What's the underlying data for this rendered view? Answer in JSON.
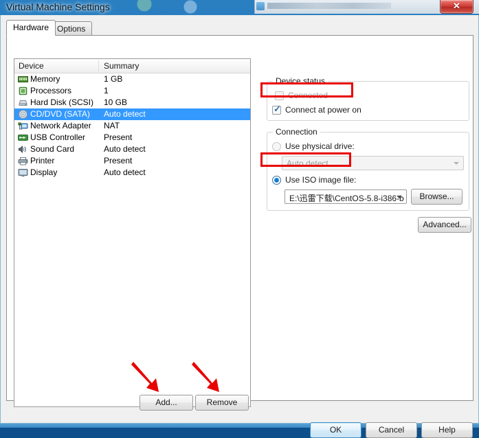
{
  "window": {
    "title": "Virtual Machine Settings",
    "close_label": "✕"
  },
  "tabs": [
    {
      "label": "Hardware",
      "active": true
    },
    {
      "label": "Options",
      "active": false
    }
  ],
  "device_list": {
    "columns": {
      "device": "Device",
      "summary": "Summary"
    },
    "rows": [
      {
        "icon": "memory-icon",
        "name": "Memory",
        "summary": "1 GB",
        "selected": false
      },
      {
        "icon": "processor-icon",
        "name": "Processors",
        "summary": "1",
        "selected": false
      },
      {
        "icon": "hard-disk-icon",
        "name": "Hard Disk (SCSI)",
        "summary": "10 GB",
        "selected": false
      },
      {
        "icon": "cd-dvd-icon",
        "name": "CD/DVD (SATA)",
        "summary": "Auto detect",
        "selected": true
      },
      {
        "icon": "network-adapter-icon",
        "name": "Network Adapter",
        "summary": "NAT",
        "selected": false
      },
      {
        "icon": "usb-controller-icon",
        "name": "USB Controller",
        "summary": "Present",
        "selected": false
      },
      {
        "icon": "sound-card-icon",
        "name": "Sound Card",
        "summary": "Auto detect",
        "selected": false
      },
      {
        "icon": "printer-icon",
        "name": "Printer",
        "summary": "Present",
        "selected": false
      },
      {
        "icon": "display-icon",
        "name": "Display",
        "summary": "Auto detect",
        "selected": false
      }
    ]
  },
  "device_status": {
    "group_title": "Device status",
    "connected": {
      "label": "Connected",
      "checked": false,
      "enabled": false
    },
    "connect_at_power_on": {
      "label": "Connect at power on",
      "checked": true,
      "enabled": true
    }
  },
  "connection": {
    "group_title": "Connection",
    "use_physical_drive": {
      "label": "Use physical drive:",
      "selected": false
    },
    "physical_drive_value": "Auto detect",
    "use_iso_image": {
      "label": "Use ISO image file:",
      "selected": true
    },
    "iso_path_value": "E:\\迅雷下载\\CentOS-5.8-i386-b",
    "browse_label": "Browse..."
  },
  "buttons": {
    "advanced": "Advanced...",
    "add": "Add...",
    "remove": "Remove",
    "ok": "OK",
    "cancel": "Cancel",
    "help": "Help"
  },
  "annotations": {
    "highlight_color": "#e80000",
    "boxes": [
      "connect-at-power-on",
      "use-iso-image-file"
    ],
    "arrows": [
      "add-button",
      "remove-button"
    ]
  },
  "colors": {
    "selection": "#3399ff",
    "annotation": "#e80000",
    "dialog_bg": "#f0f0f0"
  }
}
